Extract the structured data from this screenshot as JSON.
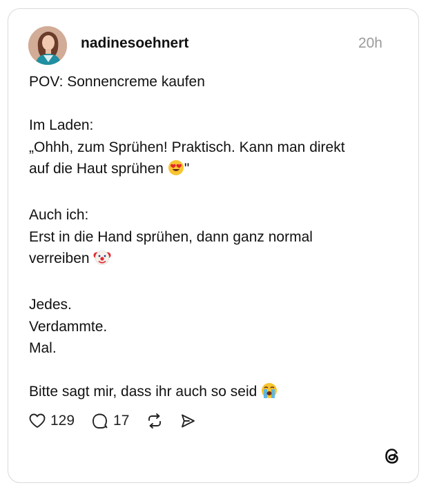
{
  "post": {
    "username": "nadinesoehnert",
    "time": "20h",
    "lines": {
      "l1": "POV: Sonnencreme kaufen",
      "l2": "Im Laden:",
      "l3": "„Ohhh, zum Sprühen! Praktisch. Kann man direkt",
      "l4": "auf die Haut sprühen",
      "l4_suffix": "\"",
      "l5": "Auch ich:",
      "l6": "Erst in die Hand sprühen, dann ganz normal",
      "l7": "verreiben",
      "l8": "Jedes.",
      "l9": "Verdammte.",
      "l10": "Mal.",
      "l11": "Bitte sagt mir, dass ihr auch so seid"
    },
    "emoji": {
      "heart_eyes": "heart-eyes-emoji",
      "clown": "clown-emoji",
      "crying": "loudly-crying-emoji"
    }
  },
  "actions": {
    "likes": "129",
    "replies": "17"
  },
  "icons": {
    "like": "heart-icon",
    "reply": "comment-icon",
    "repost": "repost-icon",
    "share": "send-icon",
    "brand": "threads-logo"
  },
  "colors": {
    "text": "#111111",
    "muted": "#9a9a9a",
    "border": "#d9d9d9"
  }
}
